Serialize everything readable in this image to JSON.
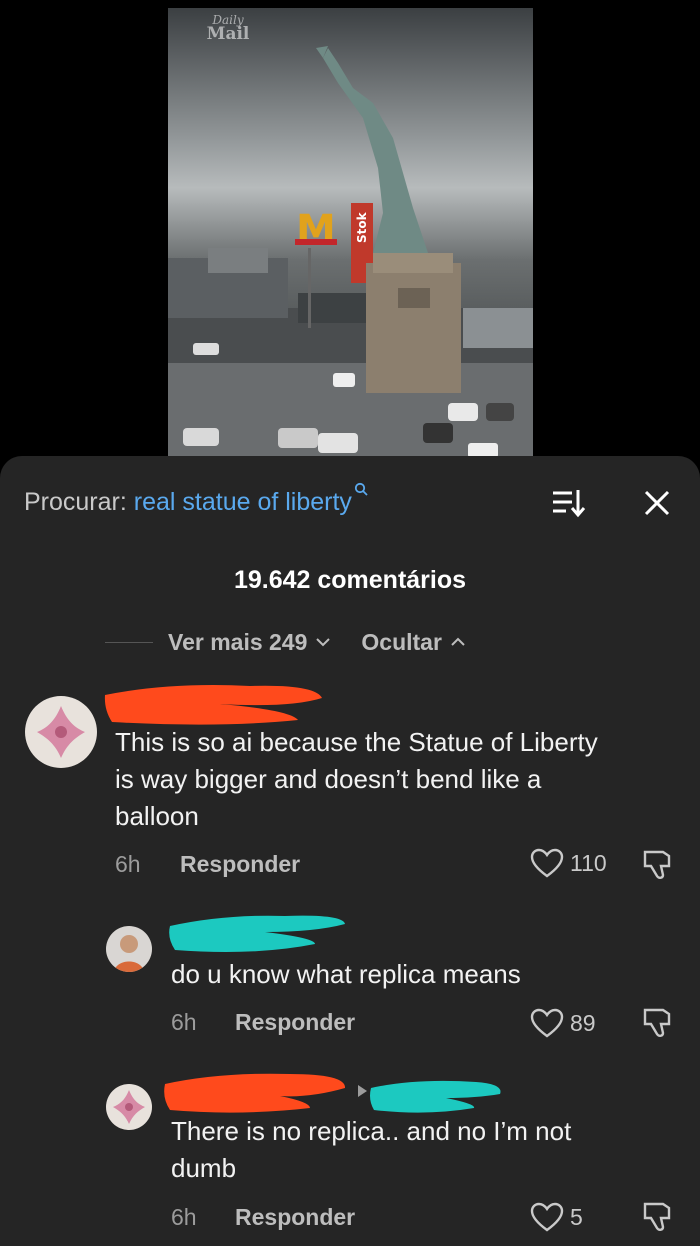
{
  "video": {
    "watermark_top": "Daily",
    "watermark_bottom": "Mail"
  },
  "sheet": {
    "search_prefix": "Procurar:",
    "search_term": "real statue of liberty",
    "comment_count": "19.642 comentários",
    "see_more": "Ver mais 249",
    "hide": "Ocultar"
  },
  "comments": [
    {
      "text_line1": "This is so ai because the Statue of Liberty",
      "text_line2": "is way bigger and doesn’t bend like a",
      "text_line3": "balloon",
      "time": "6h",
      "reply_label": "Responder",
      "likes": "110"
    },
    {
      "text_line1": "do u know what replica means",
      "time": "6h",
      "reply_label": "Responder",
      "likes": "89"
    },
    {
      "text_line1": "There is no replica.. and no I’m not",
      "text_line2": "dumb",
      "time": "6h",
      "reply_label": "Responder",
      "likes": "5"
    }
  ],
  "colors": {
    "link_blue": "#5aa9ee",
    "sheet_bg": "#252525",
    "redact_orange": "#ff4a1c",
    "redact_teal": "#1cc9c0"
  }
}
